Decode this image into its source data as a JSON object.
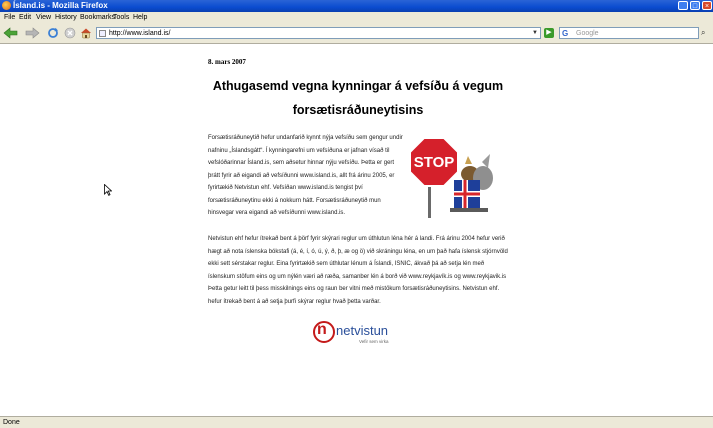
{
  "window": {
    "title": "Ísland.is - Mozilla Firefox",
    "min_label": "_",
    "max_label": "□",
    "close_label": "×"
  },
  "menu": [
    "File",
    "Edit",
    "View",
    "History",
    "Bookmarks",
    "Tools",
    "Help"
  ],
  "toolbar": {
    "url": "http://www.island.is/",
    "search_engine": "G",
    "search_placeholder": "Google",
    "icons": [
      "back-icon",
      "forward-icon",
      "reload-icon",
      "stop-icon",
      "home-icon"
    ]
  },
  "page": {
    "date": "8. mars 2007",
    "headline": "Athugasemd vegna kynningar á vefsíðu á vegum forsætisráðuneytisins",
    "paragraph1": "Forsætisráðuneytið hefur undanfarið kynnt nýja vefsíðu sem gengur undir nafninu „Íslandsgátt“. Í kynningarefni um vefsíðuna er jafnan vísað til vefslóðarinnar Ísland.is, sem aðsetur hinnar nýju vefsíðu. Þetta er gert þrátt fyrir að eigandi að vefsíðunni www.island.is, allt frá árinu 2005, er fyrirtækið Netvistun ehf. Vefsíðan www.island.is tengist því forsætisráðuneytinu ekki á nokkurn hátt. Forsætisráðuneytið mun hinsvegar vera eigandi að vefsíðunni www.island.is.",
    "paragraph2": "Netvistun ehf hefur ítrekað bent á þörf fyrir skýrari reglur um úthlutun léna hér á landi. Frá árinu 2004 hefur verið hægt að nota íslenska bókstafi (á, é, í, ó, ú, ý, ð, þ, æ og ö) við skráningu léna, en um það hafa íslensk stjórnvöld ekki sett sérstakar reglur. Eina fyrirtækið sem úthlutar lénum á Íslandi, ISNIC, ákvað þá að setja lén með íslenskum stöfum eins og um nýlén væri að ræða, samanber lén á borð við www.reykjavík.is og www.reykjavik.is Þetta getur leitt til þess misskilnings eins og raun ber vitni með mistökum forsætisráðuneytisins. Netvistun ehf. hefur ítrekað bent á að setja þurfi skýrar reglur hvað þetta varðar.",
    "stop_sign_text": "STOP",
    "logo_name": "netvistun",
    "logo_tagline": "Vefir sem virka"
  },
  "status": {
    "text": "Done"
  },
  "colors": {
    "titlebar": "#0b4cd0",
    "chrome": "#ece9d8",
    "stop_red": "#d5202b",
    "logo_red": "#c41a1a",
    "logo_blue": "#2a4f9a"
  }
}
